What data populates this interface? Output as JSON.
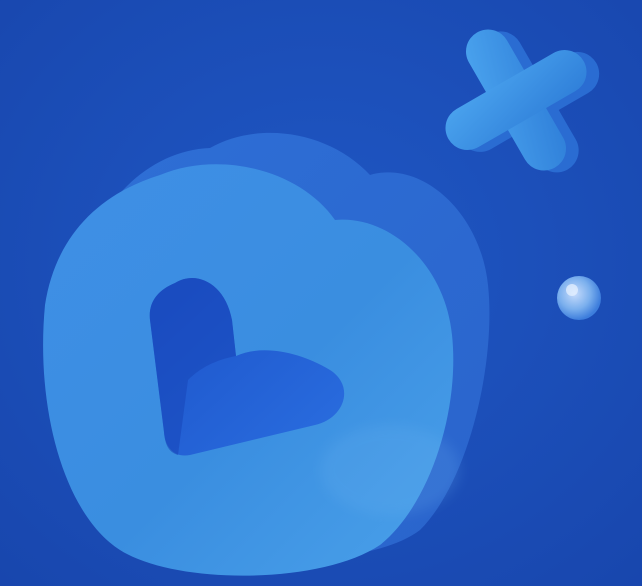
{
  "scene": {
    "background_color": "#1a4db8",
    "elements": [
      {
        "name": "heart-cutout-icon",
        "kind": "3d-heart-badge",
        "color": "#3b8ee0"
      },
      {
        "name": "cross-icon",
        "kind": "3d-plus",
        "color": "#3a90e2"
      },
      {
        "name": "sphere-icon",
        "kind": "small-glass-bead",
        "color": "#7fb4f0"
      }
    ]
  }
}
